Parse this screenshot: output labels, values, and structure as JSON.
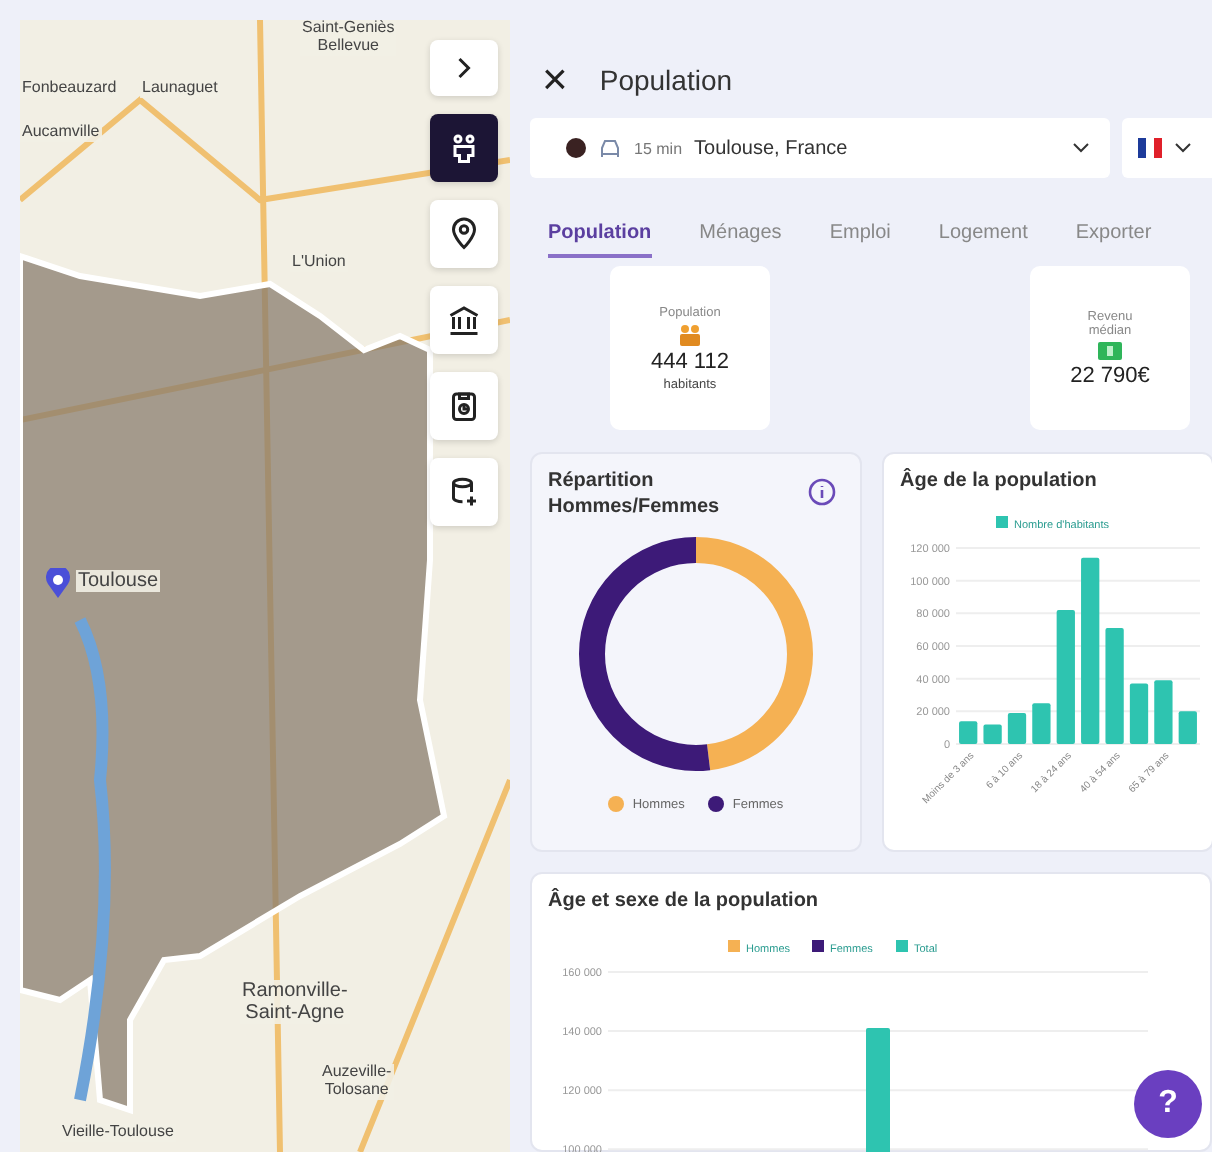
{
  "map": {
    "labels": [
      "Saint-Geniès\nBellevue",
      "Fonbeauzard",
      "Launaguet",
      "Aucamville",
      "L'Union",
      "Toulouse",
      "Ramonville-\nSaint-Agne",
      "Auzeville-\nTolosane",
      "Vieille-Toulouse"
    ],
    "tools": [
      {
        "kind": "expand",
        "selected": false
      },
      {
        "kind": "population",
        "selected": true
      },
      {
        "kind": "pin",
        "selected": false
      },
      {
        "kind": "institution",
        "selected": false
      },
      {
        "kind": "report",
        "selected": false
      },
      {
        "kind": "database",
        "selected": false
      }
    ]
  },
  "panel": {
    "title": "Population",
    "close": "×",
    "location": {
      "color": "#3a2222",
      "duration": "15 min",
      "place": "Toulouse, France"
    },
    "tabs": [
      {
        "label": "Population",
        "selected": true
      },
      {
        "label": "Ménages",
        "selected": false
      },
      {
        "label": "Emploi",
        "selected": false
      },
      {
        "label": "Logement",
        "selected": false
      },
      {
        "label": "Exporter",
        "selected": false
      }
    ],
    "kpis": [
      {
        "kind": "people",
        "title": "Population",
        "value": "444 112",
        "unit": "habitants"
      },
      {
        "kind": "money",
        "title": "Revenu\nmédian",
        "value": "22 790€"
      }
    ],
    "gender": {
      "title": "Répartition\nHommes/Femmes",
      "legend": [
        {
          "label": "Hommes",
          "color": "#f5b153"
        },
        {
          "label": "Femmes",
          "color": "#3d1a78"
        }
      ]
    },
    "age": {
      "title": "Âge de la population",
      "chart_data": {
        "type": "bar",
        "categories": [
          "Moins de 3 ans",
          null,
          "6 à 10 ans",
          null,
          "18 à 24 ans",
          null,
          "40 à 54 ans",
          null,
          "65 à 79 ans",
          null
        ],
        "series": [
          {
            "name": "Nombre d'habitants",
            "color": "#2ec4b0",
            "values": [
              14000,
              12000,
              19000,
              25000,
              82000,
              114000,
              71000,
              37000,
              39000,
              20000
            ]
          }
        ],
        "ylim": [
          0,
          120000
        ],
        "grid": true,
        "yticks": [
          {
            "value": 0,
            "label": "0"
          },
          {
            "value": 20000,
            "label": "20 000"
          },
          {
            "value": 40000,
            "label": "40 000"
          },
          {
            "value": 60000,
            "label": "60 000"
          },
          {
            "value": 80000,
            "label": "80 000"
          },
          {
            "value": 100000,
            "label": "100 000"
          },
          {
            "value": 120000,
            "label": "120 000"
          }
        ]
      }
    },
    "age_sex": {
      "title": "Âge et sexe de la population",
      "chart_data": {
        "type": "bar",
        "categories": [
          null
        ],
        "series": [
          {
            "name": "Hommes",
            "color": "#f5b153",
            "values": [
              null
            ]
          },
          {
            "name": "Femmes",
            "color": "#3d1a78",
            "values": [
              null
            ]
          },
          {
            "name": "Total",
            "color": "#2ec4b0",
            "values": [
              141000
            ]
          }
        ],
        "ylim": [
          95000,
          160000
        ],
        "grid": true,
        "yticks": [
          {
            "value": 100000,
            "label": "100 000"
          },
          {
            "value": 120000,
            "label": "120 000"
          },
          {
            "value": 140000,
            "label": "140 000"
          },
          {
            "value": 160000,
            "label": "160 000"
          }
        ]
      }
    }
  },
  "help": {
    "label": "?"
  }
}
